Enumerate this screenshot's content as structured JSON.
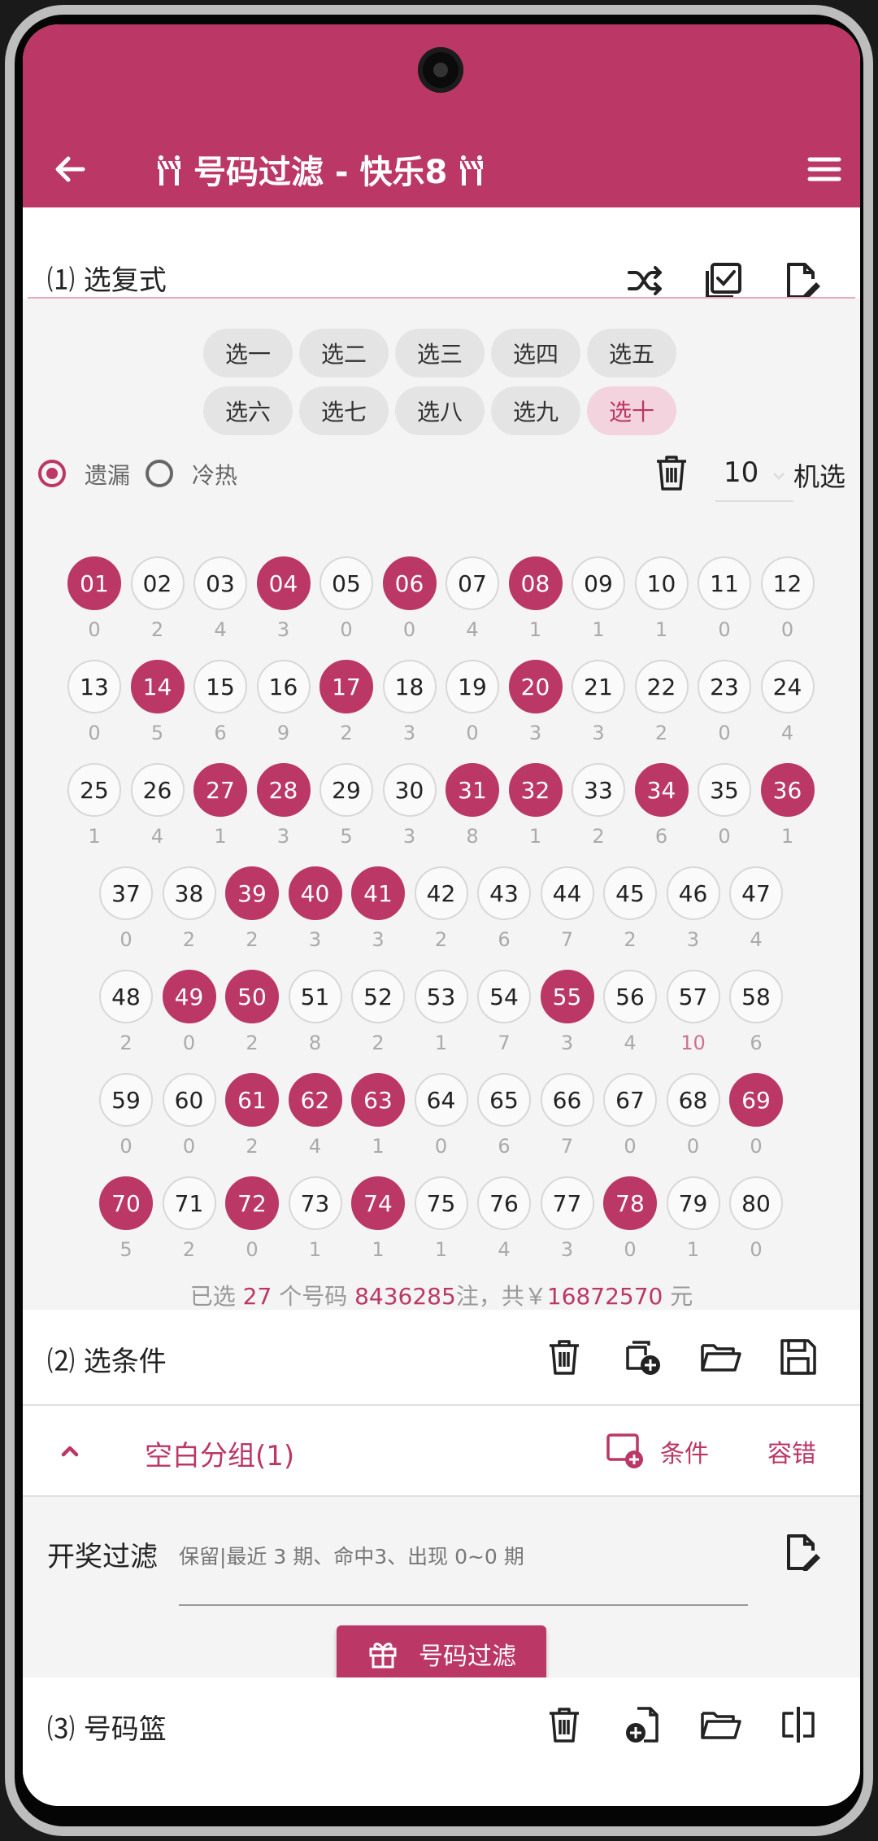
{
  "colors": {
    "accent": "#bb3766",
    "accent_light": "#f2d3de"
  },
  "app": {
    "title": "号码过滤 - 快乐8"
  },
  "section1": {
    "title": "⑴ 选复式",
    "chips_row1": [
      "选一",
      "选二",
      "选三",
      "选四",
      "选五"
    ],
    "chips_row2": [
      "选六",
      "选七",
      "选八",
      "选九",
      "选十"
    ],
    "active_chip": "选十",
    "radio_missing": "遗漏",
    "radio_hotcold": "冷热",
    "selected_radio": "遗漏",
    "random_count": "10",
    "random_label": "机选",
    "balls": [
      {
        "n": "01",
        "m": "0",
        "s": true
      },
      {
        "n": "02",
        "m": "2",
        "s": false
      },
      {
        "n": "03",
        "m": "4",
        "s": false
      },
      {
        "n": "04",
        "m": "3",
        "s": true
      },
      {
        "n": "05",
        "m": "0",
        "s": false
      },
      {
        "n": "06",
        "m": "0",
        "s": true
      },
      {
        "n": "07",
        "m": "4",
        "s": false
      },
      {
        "n": "08",
        "m": "1",
        "s": true
      },
      {
        "n": "09",
        "m": "1",
        "s": false
      },
      {
        "n": "10",
        "m": "1",
        "s": false
      },
      {
        "n": "11",
        "m": "0",
        "s": false
      },
      {
        "n": "12",
        "m": "0",
        "s": false
      },
      {
        "n": "13",
        "m": "0",
        "s": false
      },
      {
        "n": "14",
        "m": "5",
        "s": true
      },
      {
        "n": "15",
        "m": "6",
        "s": false
      },
      {
        "n": "16",
        "m": "9",
        "s": false
      },
      {
        "n": "17",
        "m": "2",
        "s": true
      },
      {
        "n": "18",
        "m": "3",
        "s": false
      },
      {
        "n": "19",
        "m": "0",
        "s": false
      },
      {
        "n": "20",
        "m": "3",
        "s": true
      },
      {
        "n": "21",
        "m": "3",
        "s": false
      },
      {
        "n": "22",
        "m": "2",
        "s": false
      },
      {
        "n": "23",
        "m": "0",
        "s": false
      },
      {
        "n": "24",
        "m": "4",
        "s": false
      },
      {
        "n": "25",
        "m": "1",
        "s": false
      },
      {
        "n": "26",
        "m": "4",
        "s": false
      },
      {
        "n": "27",
        "m": "1",
        "s": true
      },
      {
        "n": "28",
        "m": "3",
        "s": true
      },
      {
        "n": "29",
        "m": "5",
        "s": false
      },
      {
        "n": "30",
        "m": "3",
        "s": false
      },
      {
        "n": "31",
        "m": "8",
        "s": true
      },
      {
        "n": "32",
        "m": "1",
        "s": true
      },
      {
        "n": "33",
        "m": "2",
        "s": false
      },
      {
        "n": "34",
        "m": "6",
        "s": true
      },
      {
        "n": "35",
        "m": "0",
        "s": false
      },
      {
        "n": "36",
        "m": "1",
        "s": true
      },
      {
        "n": "37",
        "m": "0",
        "s": false
      },
      {
        "n": "38",
        "m": "2",
        "s": false
      },
      {
        "n": "39",
        "m": "2",
        "s": true
      },
      {
        "n": "40",
        "m": "3",
        "s": true
      },
      {
        "n": "41",
        "m": "3",
        "s": true
      },
      {
        "n": "42",
        "m": "2",
        "s": false
      },
      {
        "n": "43",
        "m": "6",
        "s": false
      },
      {
        "n": "44",
        "m": "7",
        "s": false
      },
      {
        "n": "45",
        "m": "2",
        "s": false
      },
      {
        "n": "46",
        "m": "3",
        "s": false
      },
      {
        "n": "47",
        "m": "4",
        "s": false
      },
      {
        "n": "48",
        "m": "2",
        "s": false
      },
      {
        "n": "49",
        "m": "0",
        "s": true
      },
      {
        "n": "50",
        "m": "2",
        "s": true
      },
      {
        "n": "51",
        "m": "8",
        "s": false
      },
      {
        "n": "52",
        "m": "2",
        "s": false
      },
      {
        "n": "53",
        "m": "1",
        "s": false
      },
      {
        "n": "54",
        "m": "7",
        "s": false
      },
      {
        "n": "55",
        "m": "3",
        "s": true
      },
      {
        "n": "56",
        "m": "4",
        "s": false
      },
      {
        "n": "57",
        "m": "10",
        "s": false,
        "hot": true
      },
      {
        "n": "58",
        "m": "6",
        "s": false
      },
      {
        "n": "59",
        "m": "0",
        "s": false
      },
      {
        "n": "60",
        "m": "0",
        "s": false
      },
      {
        "n": "61",
        "m": "2",
        "s": true
      },
      {
        "n": "62",
        "m": "4",
        "s": true
      },
      {
        "n": "63",
        "m": "1",
        "s": true
      },
      {
        "n": "64",
        "m": "0",
        "s": false
      },
      {
        "n": "65",
        "m": "6",
        "s": false
      },
      {
        "n": "66",
        "m": "7",
        "s": false
      },
      {
        "n": "67",
        "m": "0",
        "s": false
      },
      {
        "n": "68",
        "m": "0",
        "s": false
      },
      {
        "n": "69",
        "m": "0",
        "s": true
      },
      {
        "n": "70",
        "m": "5",
        "s": true
      },
      {
        "n": "71",
        "m": "2",
        "s": false
      },
      {
        "n": "72",
        "m": "0",
        "s": true
      },
      {
        "n": "73",
        "m": "1",
        "s": false
      },
      {
        "n": "74",
        "m": "1",
        "s": true
      },
      {
        "n": "75",
        "m": "1",
        "s": false
      },
      {
        "n": "76",
        "m": "4",
        "s": false
      },
      {
        "n": "77",
        "m": "3",
        "s": false
      },
      {
        "n": "78",
        "m": "0",
        "s": true
      },
      {
        "n": "79",
        "m": "1",
        "s": false
      },
      {
        "n": "80",
        "m": "0",
        "s": false
      }
    ],
    "summary": {
      "prefix": "已选",
      "count": "27",
      "mid1": "个号码",
      "bets": "8436285",
      "mid2": "注，共￥",
      "amount": "16872570",
      "suffix": "元"
    }
  },
  "section2": {
    "title": "⑵ 选条件",
    "group_title": "空白分组(1)",
    "condition_label": "条件",
    "tolerance_label": "容错",
    "filter_label": "开奖过滤",
    "filter_desc": "保留|最近 3 期、命中3、出现 0~0 期",
    "filter_button": "号码过滤"
  },
  "section3": {
    "title": "⑶ 号码篮"
  },
  "icons": {
    "back": "arrow-left-icon",
    "menu": "menu-icon",
    "gate": "barrier-gate-icon",
    "shuffle": "shuffle-icon",
    "check_square": "check-square-icon",
    "edit_file": "edit-file-icon",
    "trash": "trash-icon",
    "add_copy": "add-copy-icon",
    "folder": "folder-open-icon",
    "save": "save-icon",
    "chevron_up": "chevron-up-icon",
    "add_condition": "add-condition-icon",
    "gift": "gift-icon",
    "add_file": "add-file-icon",
    "split": "split-icon"
  }
}
